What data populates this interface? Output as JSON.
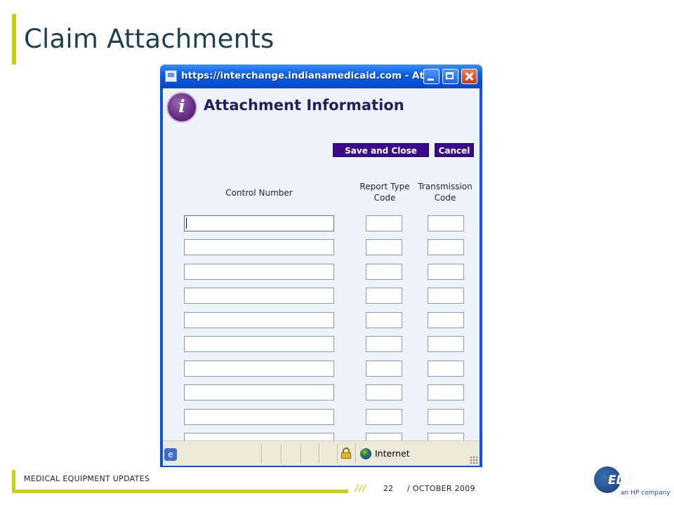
{
  "slide": {
    "title": "Claim Attachments",
    "footer_label": "MEDICAL EQUIPMENT UPDATES",
    "footer_slashes": "///",
    "page_number": "22",
    "date": "/ OCTOBER 2009",
    "brand": "EDS",
    "brand_tagline": "an HP company"
  },
  "window": {
    "title": "https://interchange.indianamedicaid.com - At...",
    "page_heading": "Attachment Information",
    "logo_letter": "i",
    "buttons": {
      "save_close": "Save and Close",
      "cancel": "Cancel"
    },
    "columns": {
      "control_number": "Control Number",
      "report_type_code": "Report Type\nCode",
      "transmission_code": "Transmission\nCode"
    },
    "rows": [
      {
        "control_number": "",
        "report_type_code": "",
        "transmission_code": ""
      },
      {
        "control_number": "",
        "report_type_code": "",
        "transmission_code": ""
      },
      {
        "control_number": "",
        "report_type_code": "",
        "transmission_code": ""
      },
      {
        "control_number": "",
        "report_type_code": "",
        "transmission_code": ""
      },
      {
        "control_number": "",
        "report_type_code": "",
        "transmission_code": ""
      },
      {
        "control_number": "",
        "report_type_code": "",
        "transmission_code": ""
      },
      {
        "control_number": "",
        "report_type_code": "",
        "transmission_code": ""
      },
      {
        "control_number": "",
        "report_type_code": "",
        "transmission_code": ""
      },
      {
        "control_number": "",
        "report_type_code": "",
        "transmission_code": ""
      },
      {
        "control_number": "",
        "report_type_code": "",
        "transmission_code": ""
      }
    ],
    "statusbar": {
      "zone": "Internet",
      "icons": [
        "ie-page-icon",
        "lock-icon",
        "globe-icon"
      ]
    }
  },
  "colors": {
    "accent": "#c8d400",
    "title": "#1e3f52",
    "button": "#3a0a8a",
    "heading": "#231f5e",
    "titlebar": "#0a5fe6"
  }
}
